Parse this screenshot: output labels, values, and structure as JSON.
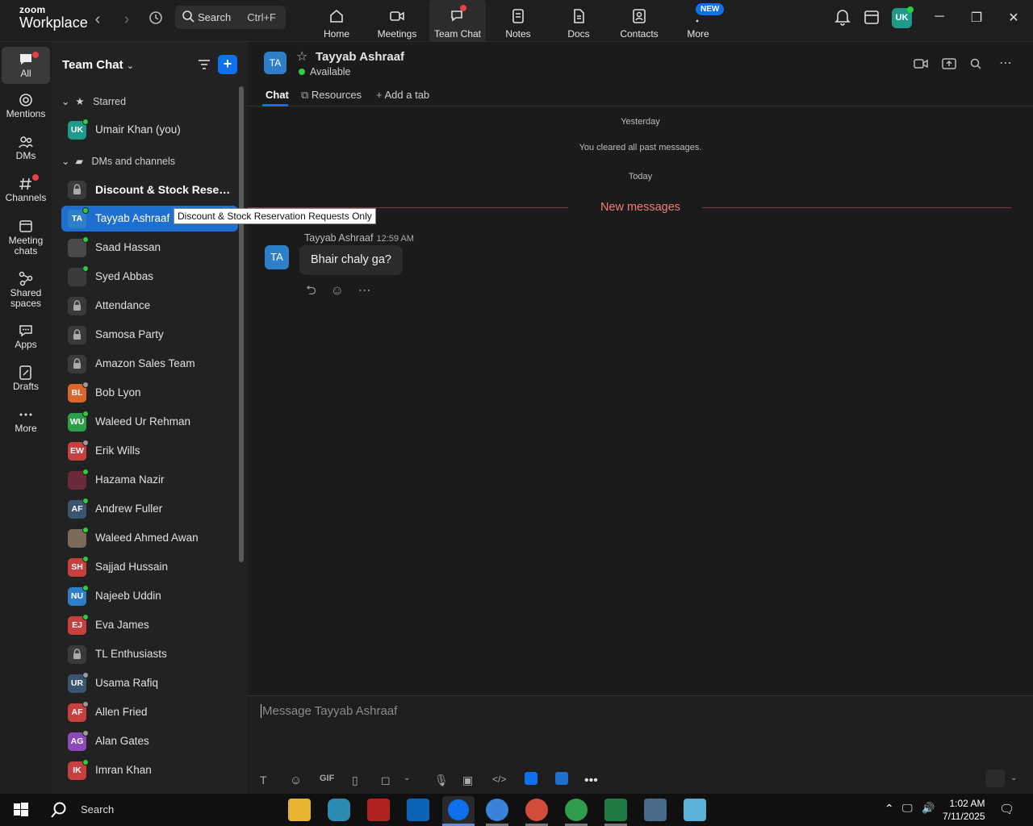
{
  "app": {
    "brand_top": "zoom",
    "brand_bottom": "Workplace"
  },
  "search": {
    "label": "Search",
    "shortcut": "Ctrl+F"
  },
  "nav": {
    "tabs": [
      "Home",
      "Meetings",
      "Team Chat",
      "Notes",
      "Docs",
      "Contacts",
      "More"
    ],
    "new_badge": "NEW"
  },
  "user": {
    "initials": "UK"
  },
  "rail": [
    "All",
    "Mentions",
    "DMs",
    "Channels",
    "Meeting chats",
    "Shared spaces",
    "Apps",
    "Drafts",
    "More"
  ],
  "sidebar": {
    "title": "Team Chat",
    "starred": "Starred",
    "dms": "DMs and channels",
    "starred_items": [
      {
        "name": "Umair Khan (you)",
        "initials": "UK",
        "color": "#1f9a8a",
        "status": "#2ecc40"
      }
    ],
    "items": [
      {
        "name": "Discount & Stock Reserv...",
        "type": "channel",
        "bold": true
      },
      {
        "name": "Tayyab Ashraaf",
        "initials": "TA",
        "color": "#2f7fc8",
        "status": "#2ecc40",
        "selected": true
      },
      {
        "name": "Saad Hassan",
        "initials": "",
        "color": "#4a4a4a",
        "status": "#2ecc40"
      },
      {
        "name": "Syed Abbas",
        "initials": "",
        "color": "#3b3b3b",
        "status": "#2ecc40"
      },
      {
        "name": "Attendance",
        "type": "channel"
      },
      {
        "name": "Samosa Party",
        "type": "channel"
      },
      {
        "name": "Amazon Sales Team",
        "type": "channel"
      },
      {
        "name": "Bob Lyon",
        "initials": "BL",
        "color": "#d9662b",
        "status": "#999"
      },
      {
        "name": "Waleed Ur Rehman",
        "initials": "WU",
        "color": "#2f9e4b",
        "status": "#2ecc40"
      },
      {
        "name": "Erik Wills",
        "initials": "EW",
        "color": "#c64040",
        "status": "#999"
      },
      {
        "name": "Hazama Nazir",
        "initials": "",
        "color": "#6a2a3a",
        "status": "#2ecc40"
      },
      {
        "name": "Andrew Fuller",
        "initials": "AF",
        "color": "#3b5570",
        "status": "#2ecc40"
      },
      {
        "name": "Waleed Ahmed Awan",
        "initials": "",
        "color": "#7a6a5a",
        "status": "#2ecc40"
      },
      {
        "name": "Sajjad Hussain",
        "initials": "SH",
        "color": "#c64040",
        "status": "#2ecc40"
      },
      {
        "name": "Najeeb Uddin",
        "initials": "NU",
        "color": "#2f7fc8",
        "status": "#2ecc40"
      },
      {
        "name": "Eva James",
        "initials": "EJ",
        "color": "#c64040",
        "status": "#2ecc40"
      },
      {
        "name": "TL Enthusiasts",
        "type": "channel"
      },
      {
        "name": "Usama Rafiq",
        "initials": "UR",
        "color": "#3b5570",
        "status": "#999"
      },
      {
        "name": "Allen Fried",
        "initials": "AF",
        "color": "#c64040",
        "status": "#999"
      },
      {
        "name": "Alan Gates",
        "initials": "AG",
        "color": "#8a4ab8",
        "status": "#999"
      },
      {
        "name": "Imran Khan",
        "initials": "IK",
        "color": "#c64040",
        "status": "#2ecc40"
      }
    ]
  },
  "chat": {
    "initials": "TA",
    "name": "Tayyab Ashraaf",
    "status": "Available",
    "tabs": [
      "Chat",
      "Resources",
      "Add a tab"
    ],
    "yesterday": "Yesterday",
    "cleared": "You cleared all past messages.",
    "today": "Today",
    "new_messages": "New messages",
    "tooltip": "Discount & Stock Reservation Requests Only",
    "message": {
      "sender": "Tayyab Ashraaf",
      "time": "12:59 AM",
      "text": "Bhair chaly ga?"
    },
    "composer_placeholder": "Message Tayyab Ashraaf",
    "gif": "GIF"
  },
  "taskbar": {
    "search": "Search",
    "time": "1:02 AM",
    "date": "7/11/2025"
  }
}
